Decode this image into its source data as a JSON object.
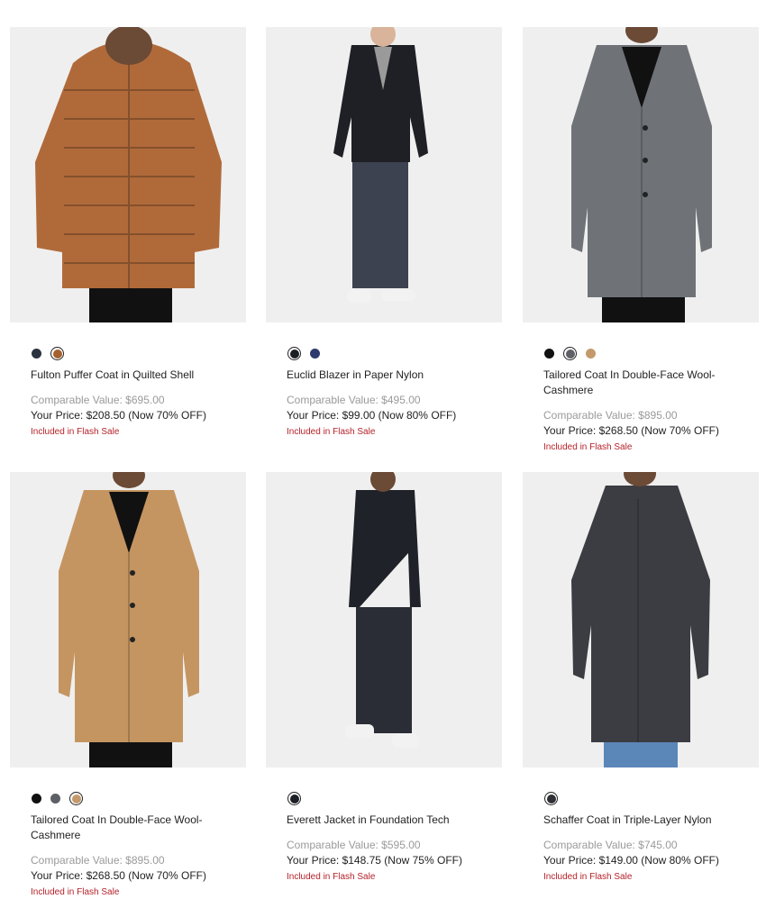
{
  "products": [
    {
      "name": "Fulton Puffer Coat in Quilted Shell",
      "comparable": "Comparable Value: $695.00",
      "price": "Your Price: $208.50 (Now 70% OFF)",
      "badge": "Included in Flash Sale",
      "swatches": [
        {
          "color": "#2c3340",
          "selected": false
        },
        {
          "color": "#a5602e",
          "selected": true
        }
      ],
      "garment": "puffer-coat",
      "garment_color": "#b06a3a"
    },
    {
      "name": "Euclid Blazer in Paper Nylon",
      "comparable": "Comparable Value: $495.00",
      "price": "Your Price: $99.00 (Now 80% OFF)",
      "badge": "Included in Flash Sale",
      "swatches": [
        {
          "color": "#1c1f26",
          "selected": true
        },
        {
          "color": "#2e3a6e",
          "selected": false
        }
      ],
      "garment": "blazer",
      "garment_color": "#1e2025"
    },
    {
      "name": "Tailored Coat In Double-Face Wool-Cashmere",
      "comparable": "Comparable Value: $895.00",
      "price": "Your Price: $268.50 (Now 70% OFF)",
      "badge": "Included in Flash Sale",
      "swatches": [
        {
          "color": "#111111",
          "selected": false
        },
        {
          "color": "#5d6066",
          "selected": true
        },
        {
          "color": "#c49a6c",
          "selected": false
        }
      ],
      "garment": "long-coat",
      "garment_color": "#6f7378"
    },
    {
      "name": "Tailored Coat In Double-Face Wool-Cashmere",
      "comparable": "Comparable Value: $895.00",
      "price": "Your Price: $268.50 (Now 70% OFF)",
      "badge": "Included in Flash Sale",
      "swatches": [
        {
          "color": "#111111",
          "selected": false
        },
        {
          "color": "#5d6066",
          "selected": false
        },
        {
          "color": "#c49a6c",
          "selected": true
        }
      ],
      "garment": "long-coat",
      "garment_color": "#c59561"
    },
    {
      "name": "Everett Jacket in Foundation Tech",
      "comparable": "Comparable Value: $595.00",
      "price": "Your Price: $148.75 (Now 75% OFF)",
      "badge": "Included in Flash Sale",
      "swatches": [
        {
          "color": "#1c1f26",
          "selected": true
        }
      ],
      "garment": "field-jacket",
      "garment_color": "#1f2228"
    },
    {
      "name": "Schaffer Coat in Triple-Layer Nylon",
      "comparable": "Comparable Value: $745.00",
      "price": "Your Price: $149.00 (Now 80% OFF)",
      "badge": "Included in Flash Sale",
      "swatches": [
        {
          "color": "#2e3035",
          "selected": true
        }
      ],
      "garment": "mac-coat",
      "garment_color": "#3b3d42"
    }
  ]
}
